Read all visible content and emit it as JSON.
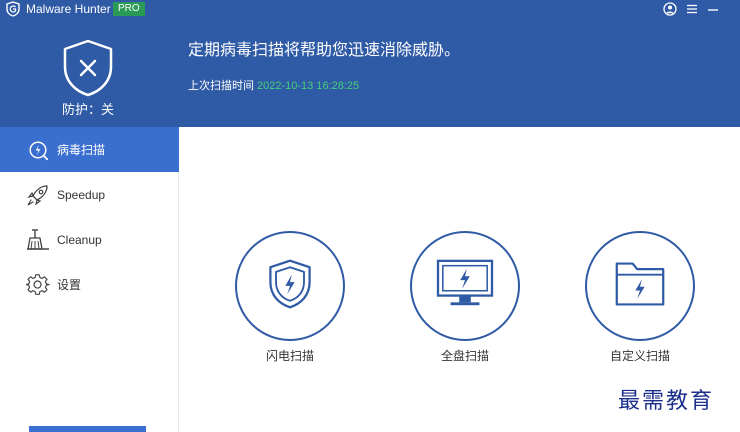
{
  "titlebar": {
    "app_name": "Malware Hunter",
    "badge": "PRO",
    "icons": [
      "shield-logo-icon",
      "user-icon",
      "menu-icon",
      "minimize-icon"
    ]
  },
  "header": {
    "protection_label": "防护：关",
    "headline": "定期病毒扫描将帮助您迅速消除威胁。",
    "last_scan_label": "上次扫描时间",
    "last_scan_time": "2022-10-13 16:28:25"
  },
  "sidebar": {
    "items": [
      {
        "label": "病毒扫描",
        "icon": "virus-scan-icon",
        "active": true
      },
      {
        "label": "Speedup",
        "icon": "rocket-icon",
        "active": false
      },
      {
        "label": "Cleanup",
        "icon": "broom-icon",
        "active": false
      },
      {
        "label": "设置",
        "icon": "gear-icon",
        "active": false
      }
    ]
  },
  "scans": [
    {
      "label": "闪电扫描",
      "icon": "shield-bolt-icon"
    },
    {
      "label": "全盘扫描",
      "icon": "monitor-bolt-icon"
    },
    {
      "label": "自定义扫描",
      "icon": "folder-bolt-icon"
    }
  ],
  "watermark": "最需教育",
  "colors": {
    "header_bg": "#2f5aa5",
    "active_nav": "#3a6fd0",
    "timestamp": "#44d17a",
    "badge": "#2a9b56",
    "icon_blue": "#2f5aa5"
  }
}
